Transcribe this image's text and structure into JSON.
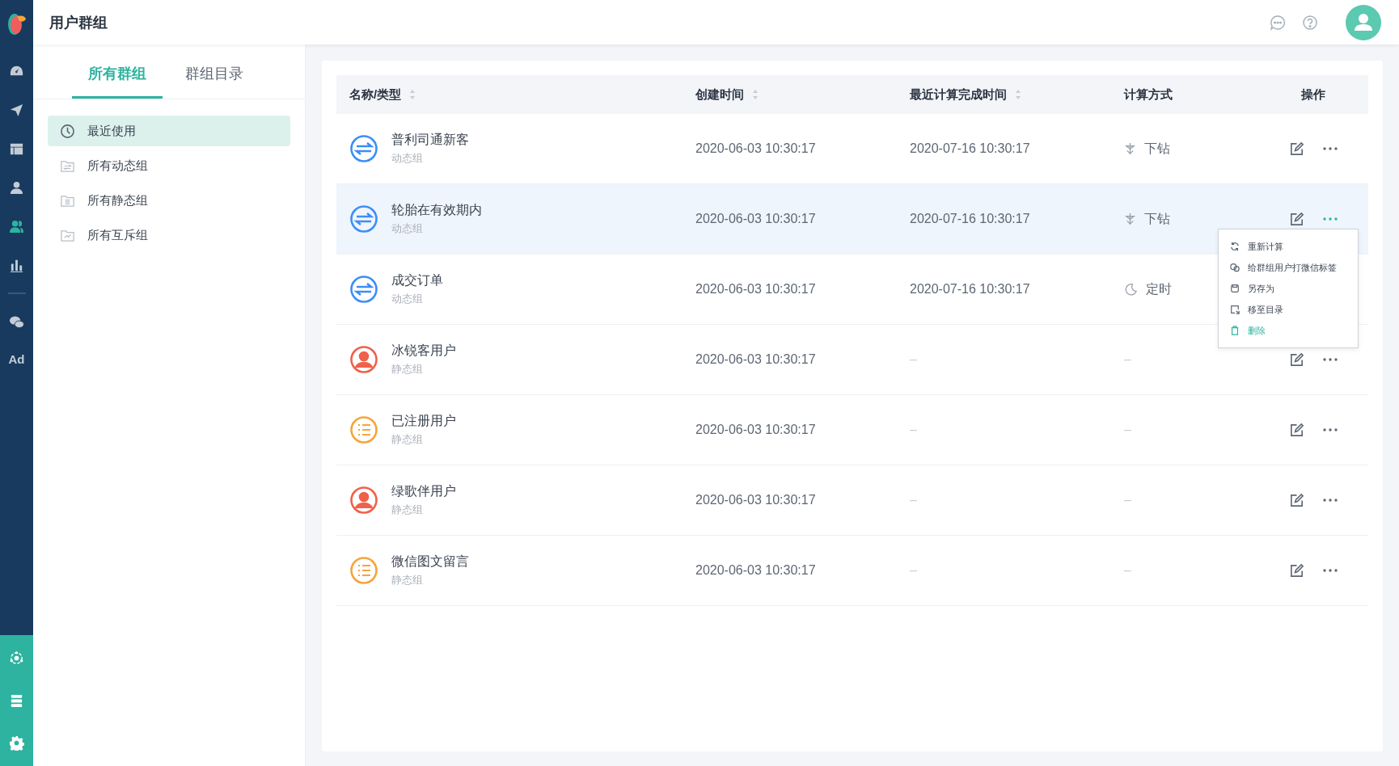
{
  "app_nav": {
    "items": [
      {
        "kind": "gauge",
        "selected": false
      },
      {
        "kind": "send",
        "selected": false
      },
      {
        "kind": "layout",
        "selected": false
      },
      {
        "kind": "user",
        "selected": false
      },
      {
        "kind": "users",
        "selected": true
      },
      {
        "kind": "chart",
        "selected": false
      },
      {
        "kind": "divider"
      },
      {
        "kind": "wechat",
        "selected": false
      },
      {
        "kind": "text",
        "label": "Ad",
        "selected": false
      }
    ],
    "bottom": [
      {
        "kind": "hub"
      },
      {
        "kind": "list"
      },
      {
        "kind": "gear"
      }
    ]
  },
  "header": {
    "title": "用户群组"
  },
  "panel": {
    "tabs": [
      {
        "label": "所有群组",
        "selected": true
      },
      {
        "label": "群组目录",
        "selected": false
      }
    ],
    "groups": [
      {
        "label": "最近使用",
        "kind": "clock",
        "selected": true
      },
      {
        "label": "所有动态组",
        "kind": "dynamic",
        "selected": false
      },
      {
        "label": "所有静态组",
        "kind": "static",
        "selected": false
      },
      {
        "label": "所有互斥组",
        "kind": "exclusive",
        "selected": false
      }
    ]
  },
  "table": {
    "columns": [
      {
        "label": "名称/类型",
        "sortable": true
      },
      {
        "label": "创建时间",
        "sortable": true
      },
      {
        "label": "最近计算完成时间",
        "sortable": true
      },
      {
        "label": "计算方式",
        "sortable": false
      },
      {
        "label": "操作",
        "sortable": false
      }
    ],
    "rows": [
      {
        "name": "普利司通新客",
        "type": "动态组",
        "kind": "dynamic",
        "created": "2020-06-03 10:30:17",
        "last_computed": "2020-07-16 10:30:17",
        "method": {
          "kind": "drill",
          "label": "下钻"
        },
        "hovered": false,
        "menu_open": false
      },
      {
        "name": "轮胎在有效期内",
        "type": "动态组",
        "kind": "dynamic",
        "created": "2020-06-03 10:30:17",
        "last_computed": "2020-07-16 10:30:17",
        "method": {
          "kind": "drill",
          "label": "下钻"
        },
        "hovered": true,
        "menu_open": true
      },
      {
        "name": "成交订单",
        "type": "动态组",
        "kind": "dynamic",
        "created": "2020-06-03 10:30:17",
        "last_computed": "2020-07-16 10:30:17",
        "method": {
          "kind": "timer",
          "label": "定时"
        },
        "hovered": false,
        "menu_open": false
      },
      {
        "name": "冰锐客用户",
        "type": "静态组",
        "kind": "person",
        "created": "2020-06-03 10:30:17",
        "last_computed": "–",
        "method": {
          "kind": "none",
          "label": "–"
        },
        "hovered": false,
        "menu_open": false
      },
      {
        "name": "已注册用户",
        "type": "静态组",
        "kind": "list",
        "created": "2020-06-03 10:30:17",
        "last_computed": "–",
        "method": {
          "kind": "none",
          "label": "–"
        },
        "hovered": false,
        "menu_open": false
      },
      {
        "name": "绿歌伴用户",
        "type": "静态组",
        "kind": "person",
        "created": "2020-06-03 10:30:17",
        "last_computed": "–",
        "method": {
          "kind": "none",
          "label": "–"
        },
        "hovered": false,
        "menu_open": false
      },
      {
        "name": "微信图文留言",
        "type": "静态组",
        "kind": "list",
        "created": "2020-06-03 10:30:17",
        "last_computed": "–",
        "method": {
          "kind": "none",
          "label": "–"
        },
        "hovered": false,
        "menu_open": false
      }
    ]
  },
  "row_menu": {
    "items": [
      {
        "label": "重新计算",
        "kind": "refresh"
      },
      {
        "label": "给群组用户打微信标签",
        "kind": "tag"
      },
      {
        "label": "另存为",
        "kind": "save"
      },
      {
        "label": "移至目录",
        "kind": "move"
      },
      {
        "label": "删除",
        "kind": "delete"
      }
    ]
  }
}
